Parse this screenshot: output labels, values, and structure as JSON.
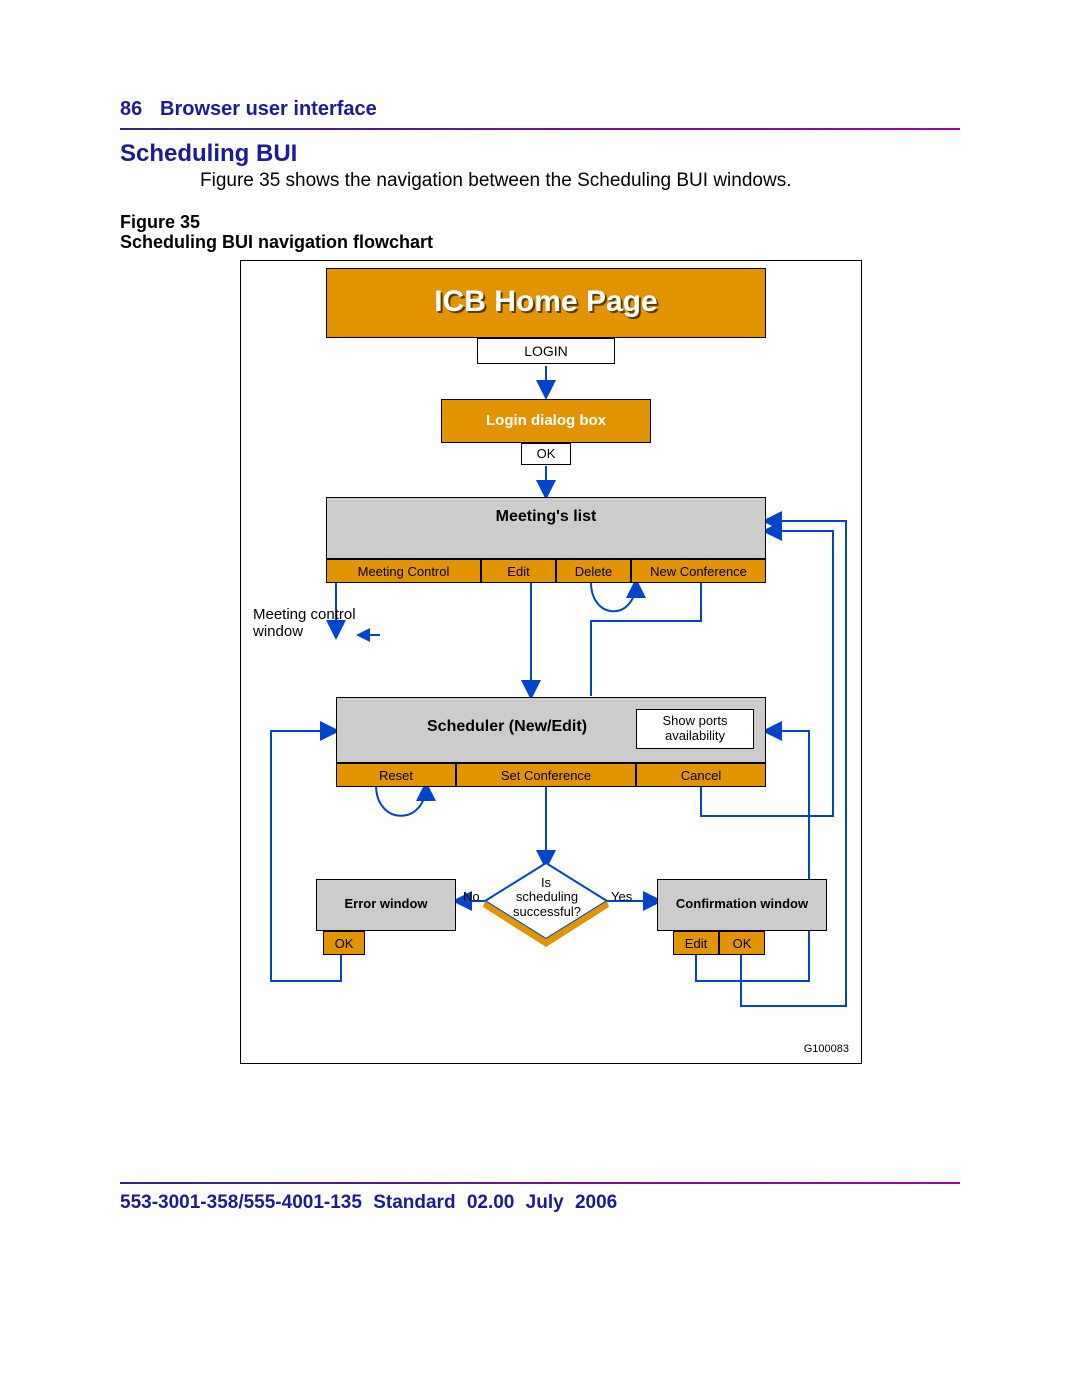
{
  "page_number": "86",
  "header": "Browser user interface",
  "section_title": "Scheduling BUI",
  "intro": "Figure 35 shows the navigation between the Scheduling BUI windows.",
  "figure_label": "Figure 35",
  "figure_caption": "Scheduling BUI navigation flowchart",
  "footer": "553-3001-358/555-4001-135   Standard   02.00   July 2006",
  "figure_id": "G100083",
  "fc": {
    "home_title": "ICB Home Page",
    "login": "LOGIN",
    "login_dialog": "Login dialog box",
    "ok": "OK",
    "meetings_list": "Meeting's list",
    "meeting_control_btn": "Meeting Control",
    "edit": "Edit",
    "delete": "Delete",
    "new_conference": "New Conference",
    "meeting_control_window": "Meeting control window",
    "scheduler": "Scheduler (New/Edit)",
    "show_ports1": "Show ports",
    "show_ports2": "availability",
    "reset": "Reset",
    "set_conference": "Set Conference",
    "cancel": "Cancel",
    "error_window": "Error window",
    "no": "No",
    "decision1": "Is",
    "decision2": "scheduling",
    "decision3": "successful?",
    "yes": "Yes",
    "confirmation_window": "Confirmation window",
    "edit_btn": "Edit",
    "ok_btn": "OK"
  }
}
